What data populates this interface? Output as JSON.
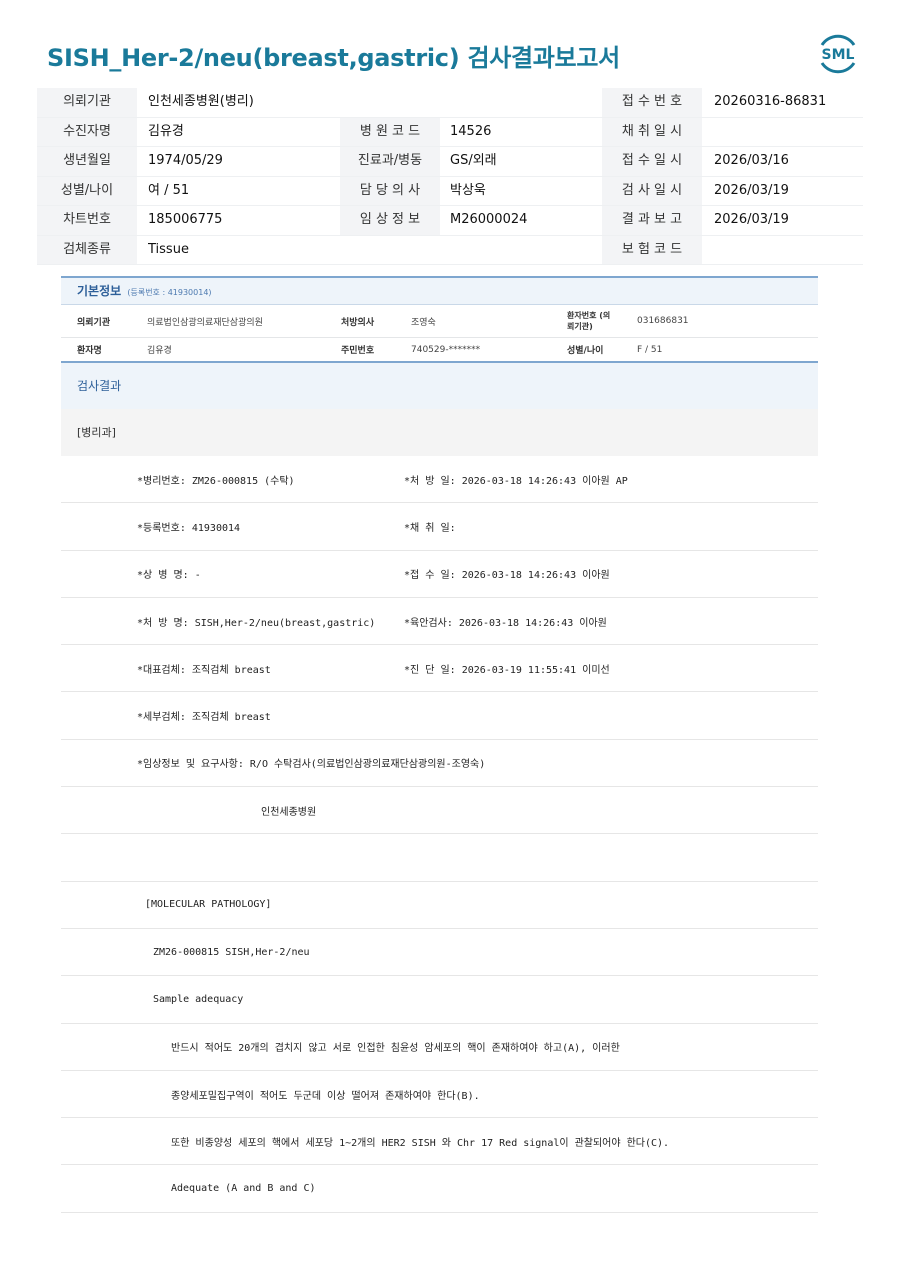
{
  "title": "SISH_Her-2/neu(breast,gastric) 검사결과보고서",
  "logo_text": "SML",
  "header": {
    "rows": [
      {
        "l1": "의뢰기관",
        "v1": "인천세종병원(병리)",
        "l2": "",
        "v2": "",
        "l3": "접 수 번 호",
        "v3": "20260316-86831"
      },
      {
        "l1": "수진자명",
        "v1": "김유경",
        "l2": "병 원 코 드",
        "v2": "14526",
        "l3": "채 취 일 시",
        "v3": ""
      },
      {
        "l1": "생년월일",
        "v1": "1974/05/29",
        "l2": "진료과/병동",
        "v2": "GS/외래",
        "l3": "접 수 일 시",
        "v3": "2026/03/16"
      },
      {
        "l1": "성별/나이",
        "v1": "여 / 51",
        "l2": "담 당 의 사",
        "v2": "박상욱",
        "l3": "검 사 일 시",
        "v3": "2026/03/19"
      },
      {
        "l1": "차트번호",
        "v1": "185006775",
        "l2": "임 상 정 보",
        "v2": "M26000024",
        "l3": "결 과 보 고",
        "v3": "2026/03/19"
      },
      {
        "l1": "검체종류",
        "v1": "Tissue",
        "l2": "",
        "v2": "",
        "l3": "보 험 코 드",
        "v3": ""
      }
    ]
  },
  "basic": {
    "title": "기본정보",
    "reg": "(등록번호 : 41930014)",
    "r1": {
      "k1": "의뢰기관",
      "v1": "의료법인삼광의료재단삼광의원",
      "k2": "처방의사",
      "v2": "조영숙",
      "k3": "환자번호 (의뢰기관)",
      "v3": "031686831"
    },
    "r2": {
      "k1": "환자명",
      "v1": "김유경",
      "k2": "주민번호",
      "v2": "740529-*******",
      "k3": "성별/나이",
      "v3": "F / 51"
    }
  },
  "results": {
    "heading": "검사결과",
    "dept": "[병리과]",
    "rows": [
      {
        "a": "*병리번호: ZM26-000815 (수탁)",
        "b": "*처 방 일: 2026-03-18 14:26:43  이아원 AP"
      },
      {
        "a": "*등록번호: 41930014",
        "b": "*채 취 일:"
      },
      {
        "a": "*상 병 명: -",
        "b": "*접 수 일: 2026-03-18 14:26:43  이아원"
      },
      {
        "a": "*처 방 명: SISH,Her-2/neu(breast,gastric)",
        "b": "*육안검사: 2026-03-18 14:26:43  이아원"
      },
      {
        "a": "*대표검체: 조직검체 breast",
        "b": "*진 단 일: 2026-03-19 11:55:41  이미선"
      },
      {
        "a": "*세부검체: 조직검체 breast",
        "b": ""
      },
      {
        "a": "*임상정보 및 요구사항: R/O 수탁검사(의료법인삼광의료재단삼광의원-조영숙)",
        "b": ""
      },
      {
        "a": "인천세종병원",
        "b": ""
      },
      {
        "a": "",
        "b": ""
      },
      {
        "a": "[MOLECULAR PATHOLOGY]",
        "b": ""
      },
      {
        "a": "ZM26-000815     SISH,Her-2/neu",
        "b": ""
      },
      {
        "a": "Sample adequacy",
        "b": ""
      },
      {
        "a": "반드시 적어도 20개의 겹치지 않고 서로 인접한 침윤성 암세포의 핵이 존재하여야 하고(A), 이러한",
        "b": ""
      },
      {
        "a": "종양세포밀집구역이 적어도 두군데 이상 떨어져 존재하여야 한다(B).",
        "b": ""
      },
      {
        "a": "또한 비종양성 세포의 핵에서 세포당 1~2개의 HER2 SISH 와 Chr 17 Red signal이 관찰되어야 한다(C).",
        "b": ""
      },
      {
        "a": "Adequate (A and B and C)",
        "b": ""
      }
    ]
  }
}
